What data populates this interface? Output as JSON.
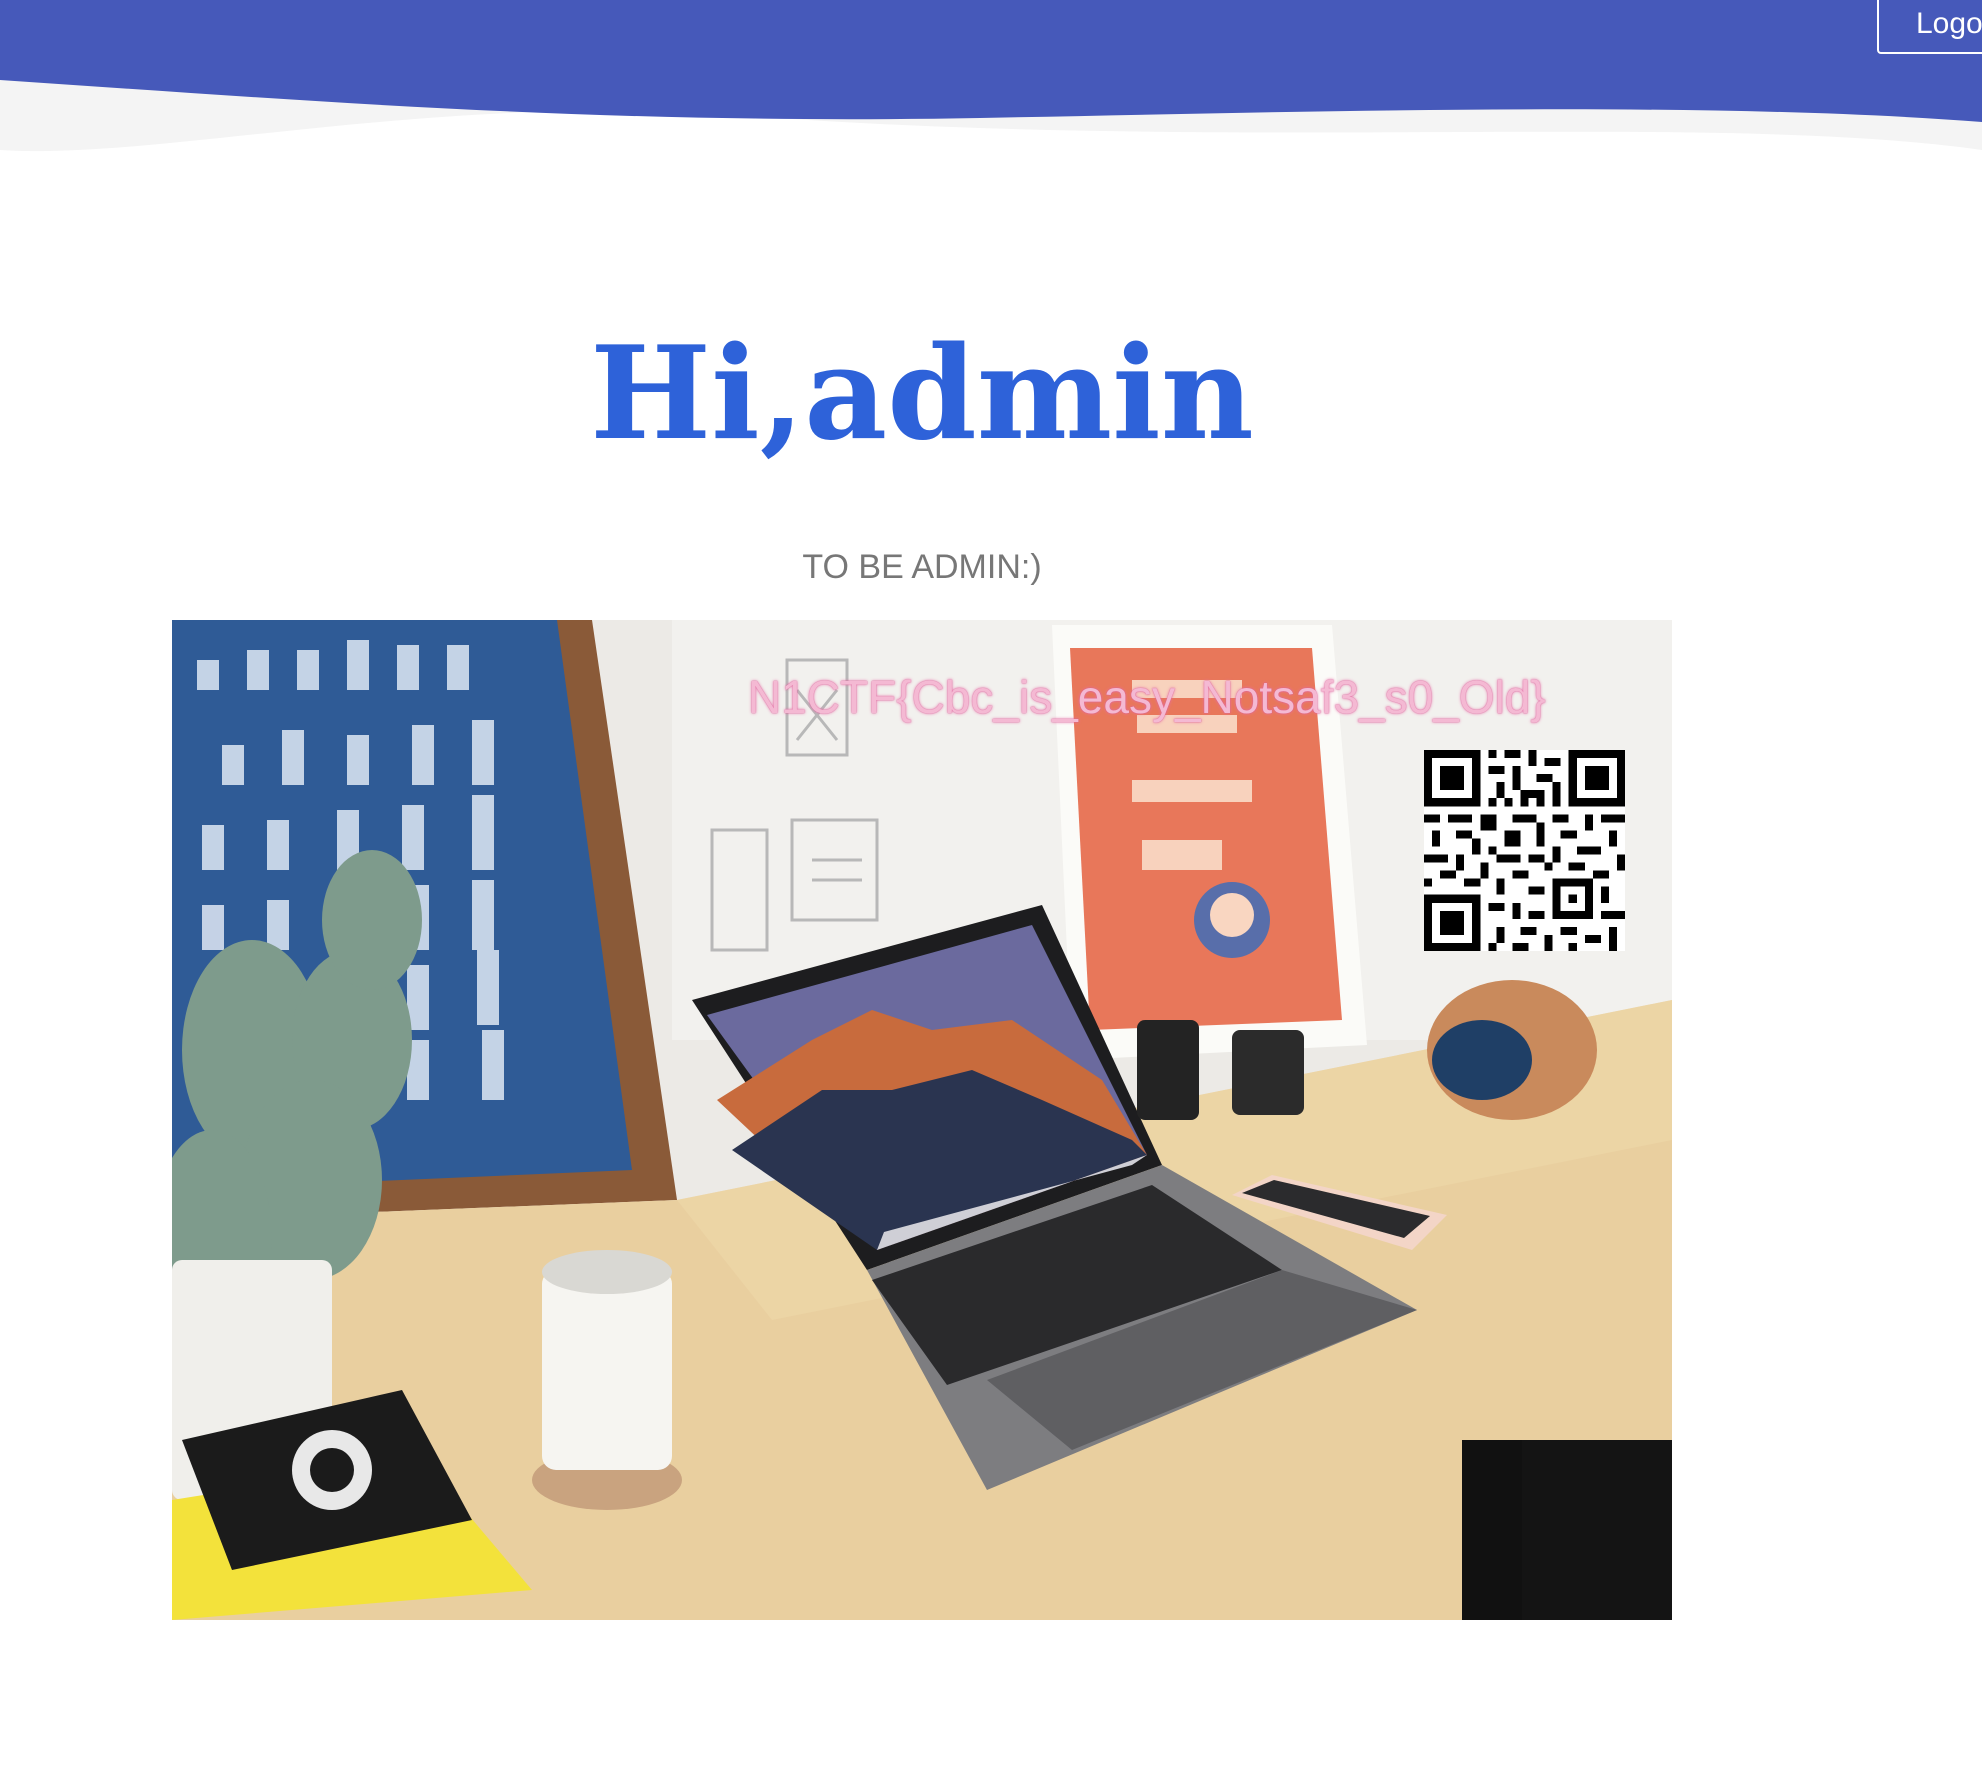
{
  "header": {
    "logout_label": "Logout",
    "color": "#4659ba"
  },
  "main": {
    "title": "Hi,admin",
    "subtitle": "TO BE ADMIN:)",
    "title_color": "#2e62d9"
  },
  "hero": {
    "overlay_text": "N1CTF{Cbc_is_easy_Notsaf3_s0_Old}",
    "overlay_color": "#f4b9d3"
  }
}
